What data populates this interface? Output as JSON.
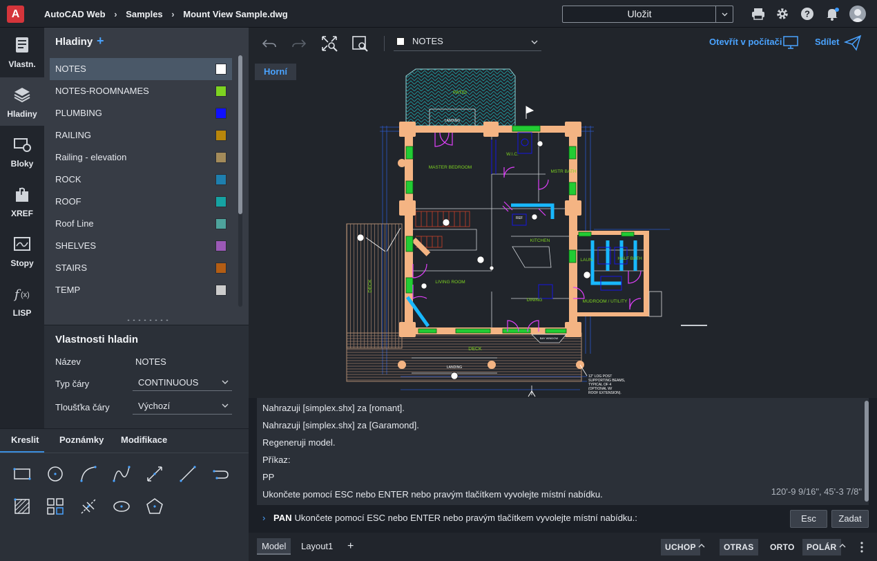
{
  "header": {
    "logo": "A",
    "breadcrumbs": [
      "AutoCAD Web",
      "Samples",
      "Mount View Sample.dwg"
    ],
    "save_label": "Uložit",
    "icons": [
      "print-icon",
      "gear-icon",
      "help-icon",
      "bell-icon",
      "user-avatar"
    ]
  },
  "rail": {
    "items": [
      {
        "label": "Vlastn.",
        "icon": "properties-icon"
      },
      {
        "label": "Hladiny",
        "icon": "layers-icon"
      },
      {
        "label": "Bloky",
        "icon": "blocks-icon"
      },
      {
        "label": "XREF",
        "icon": "xref-icon"
      },
      {
        "label": "Stopy",
        "icon": "traces-icon"
      },
      {
        "label": "LISP",
        "icon": "lisp-icon"
      }
    ],
    "active_index": 1
  },
  "layers_panel": {
    "title": "Hladiny",
    "layers": [
      {
        "name": "NOTES",
        "color": "#ffffff",
        "selected": true
      },
      {
        "name": "NOTES-ROOMNAMES",
        "color": "#7ed321"
      },
      {
        "name": "PLUMBING",
        "color": "#1010ff"
      },
      {
        "name": "RAILING",
        "color": "#b8860b"
      },
      {
        "name": "Railing - elevation",
        "color": "#a38b5a"
      },
      {
        "name": "ROCK",
        "color": "#1e7fae"
      },
      {
        "name": "ROOF",
        "color": "#16a3a3"
      },
      {
        "name": "Roof Line",
        "color": "#4ea39c"
      },
      {
        "name": "SHELVES",
        "color": "#9b59b6"
      },
      {
        "name": "STAIRS",
        "color": "#b35d14"
      },
      {
        "name": "TEMP",
        "color": "#cccccc"
      }
    ]
  },
  "layer_properties": {
    "title": "Vlastnosti hladin",
    "name_label": "Název",
    "name_value": "NOTES",
    "linetype_label": "Typ čáry",
    "linetype_value": "CONTINUOUS",
    "lineweight_label": "Tloušťka čáry",
    "lineweight_value": "Výchozí"
  },
  "draw_panel": {
    "tabs": [
      "Kreslit",
      "Poznámky",
      "Modifikace"
    ],
    "active_tab": 0
  },
  "canvas_toolbar": {
    "current_layer": "NOTES",
    "open_desktop": "Otevřít v počítači",
    "share": "Sdílet"
  },
  "view_label": "Horní",
  "command_history": [
    "Nahrazuji [simplex.shx] za [romant].",
    "Nahrazuji [simplex.shx] za [Garamond].",
    "Regeneruji model.",
    "Příkaz:",
    "PP",
    "Ukončete pomocí ESC nebo ENTER nebo pravým tlačítkem vyvolejte místní nabídku."
  ],
  "coordinates": "120'-9 9/16\", 45'-3 7/8\"",
  "command_line": {
    "command": "PAN",
    "prompt": "Ukončete pomocí ESC nebo ENTER nebo pravým tlačítkem vyvolejte místní nabídku.:",
    "esc_label": "Esc",
    "enter_label": "Zadat"
  },
  "status_bar": {
    "tabs": [
      "Model",
      "Layout1"
    ],
    "active_tab": 0,
    "toggles": [
      "UCHOP",
      "OTRAS",
      "ORTO",
      "POLÁR"
    ]
  },
  "drawing_labels": {
    "patio": "PATIO",
    "landing": "LANDING",
    "master": "MASTER BEDROOM",
    "wic": "W.I.C.",
    "mstr_bath": "MSTR BATH",
    "ref": "REF",
    "kitchen": "KITCHEN",
    "laun": "LAUN.",
    "half_bath": "HALF BATH",
    "living": "LIVING ROOM",
    "dining": "DINING",
    "mudroom": "MUDROOM / UTILITY",
    "deck_side": "DECK",
    "deck_bottom": "DECK",
    "bay": "BAY WINDOW",
    "landing2": "LANDING",
    "note1": "12\" LOG POST",
    "note2": "SUPPORTING BEAMS,",
    "note3": "TYPICAL OF 4",
    "note4": "(OPTIONAL W/",
    "note5": "ROOF EXTENSION)."
  },
  "colors": {
    "accent": "#4aa3ff",
    "log_wall": "#f4b483",
    "window": "#22cc33",
    "door": "#e040fb",
    "plumbing": "#18b8ff",
    "dimension": "#2b57c9"
  }
}
